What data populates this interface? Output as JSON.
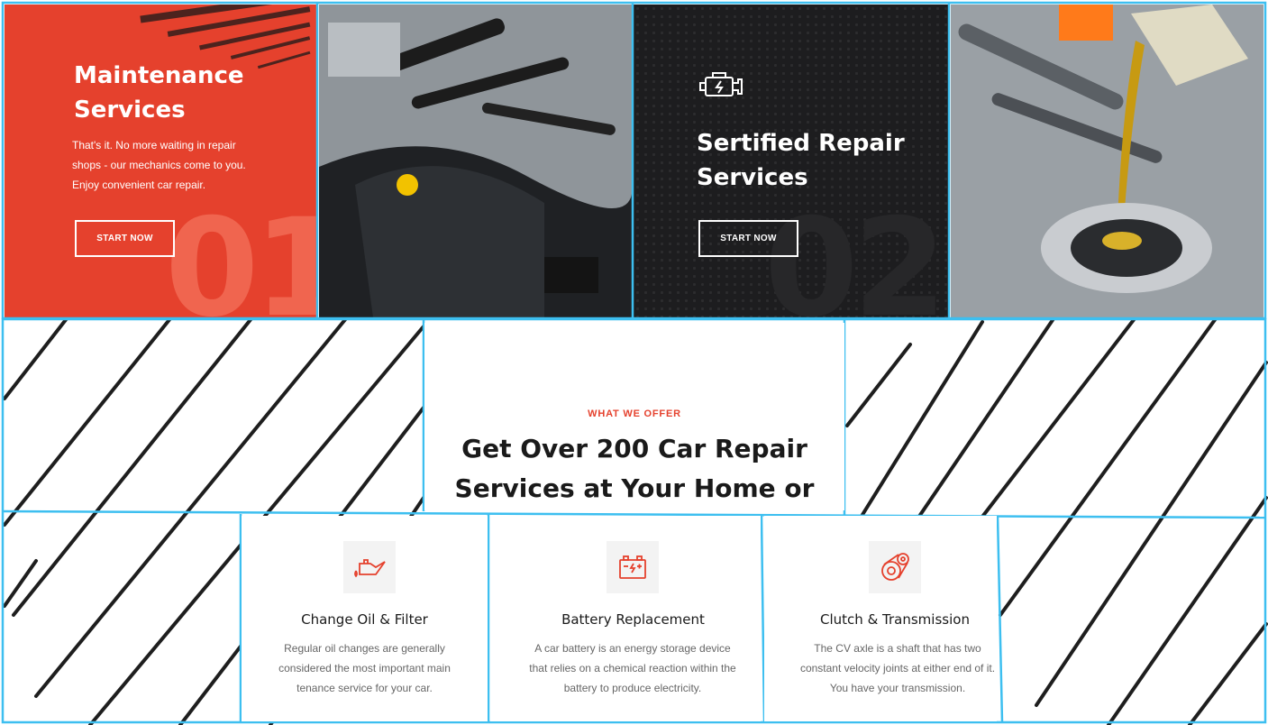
{
  "promo": {
    "maintenance": {
      "title": "Maintenance Services",
      "text": "That's it. No more waiting in repair shops - our mechanics come to you. Enjoy convenient car repair.",
      "button": "START NOW",
      "number": "01",
      "bg_color": "#e5412d"
    },
    "certified": {
      "title": "Sertified Repair Services",
      "button": "START NOW",
      "number": "02",
      "icon": "engine-icon",
      "bg_color": "#1d1d1f"
    },
    "photos": [
      "engine-photo",
      "oil-pour-photo"
    ]
  },
  "offer": {
    "eyebrow": "WHAT WE OFFER",
    "headline_line1": "Get Over 200 Car Repair",
    "headline_line2": "Services at Your Home or Office",
    "accent": "#e5412d"
  },
  "services": [
    {
      "icon": "oil-can-icon",
      "title": "Change Oil & Filter",
      "text": "Regular oil changes are generally considered the most important main tenance service for your car."
    },
    {
      "icon": "battery-icon",
      "title": "Battery Replacement",
      "text": "A car battery is an energy storage device that relies on a chemical reaction within the battery to produce electricity."
    },
    {
      "icon": "gear-belt-icon",
      "title": "Clutch & Transmission",
      "text": "The CV axle is a shaft that has two constant velocity joints at either end of it. You have your transmission."
    }
  ]
}
